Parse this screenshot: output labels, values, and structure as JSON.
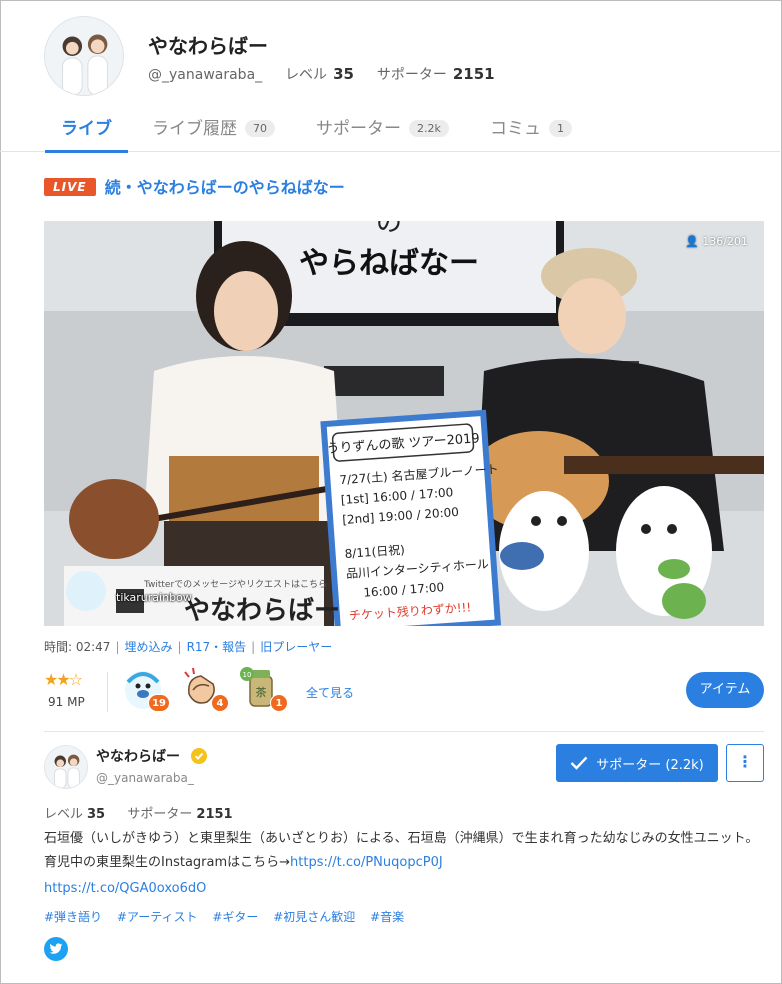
{
  "profile": {
    "name": "やなわらばー",
    "handle": "@_yanawaraba_",
    "level_label": "レベル",
    "level": "35",
    "supporter_label": "サポーター",
    "supporters": "2151"
  },
  "tabs": [
    {
      "label": "ライブ",
      "count": ""
    },
    {
      "label": "ライブ履歴",
      "count": "70"
    },
    {
      "label": "サポーター",
      "count": "2.2k"
    },
    {
      "label": "コミュ",
      "count": "1"
    }
  ],
  "live": {
    "badge": "LIVE",
    "title": "続・やなわらばーのやらねばなー",
    "viewers": "136/201",
    "broadcaster_tag": "tikarurainbow"
  },
  "video_info": {
    "time_label": "時間: 02:47",
    "embed": "埋め込み",
    "report": "R17・報告",
    "old_player": "旧プレーヤー"
  },
  "rating": {
    "stars": "★★☆",
    "mp": "91 MP"
  },
  "gifts": [
    {
      "icon": "mascot-gift-icon",
      "count": "19"
    },
    {
      "icon": "clap-gift-icon",
      "count": "4"
    },
    {
      "icon": "tea-gift-icon",
      "count": "1"
    }
  ],
  "see_all": "全て見る",
  "item_button": "アイテム",
  "broadcaster": {
    "name": "やなわらばー",
    "handle": "@_yanawaraba_",
    "support_button": "サポーター (2.2k)",
    "level_label": "レベル",
    "level": "35",
    "supporter_label": "サポーター",
    "supporters": "2151",
    "description": "石垣優（いしがきゆう）と東里梨生（あいざとりお）による、石垣島（沖縄県）で生まれ育った幼なじみの女性ユニット。 育児中の東里梨生のInstagramはこちら→",
    "description_link": "https://t.co/PNuqopcP0J",
    "link2": "https://t.co/QGA0oxo6dO",
    "tags": [
      "#弾き語り",
      "#アーティスト",
      "#ギター",
      "#初見さん歓迎",
      "#音楽"
    ]
  },
  "colors": {
    "accent": "#2b7fe0",
    "live": "#e8562a",
    "badge": "#ef6a1f",
    "twitter": "#1da1f2"
  }
}
